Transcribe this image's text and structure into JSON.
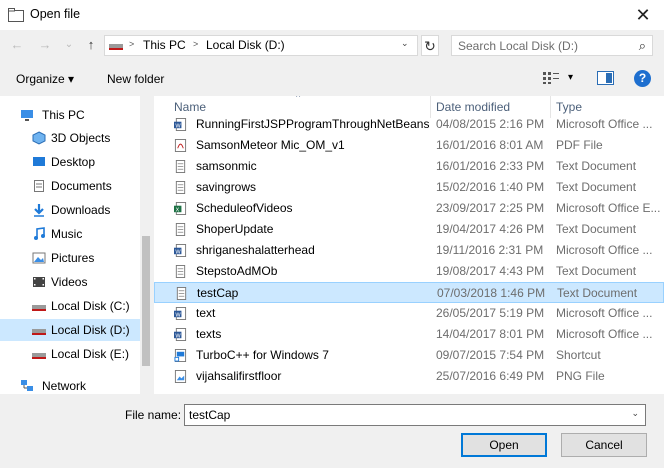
{
  "window": {
    "title": "Open file",
    "close_glyph": "✕"
  },
  "nav": {
    "back": "←",
    "forward": "→",
    "recent": "⌄",
    "up": "↑"
  },
  "address": {
    "sep1": ">",
    "crumb1": "This PC",
    "sep2": ">",
    "crumb2": "Local Disk (D:)",
    "dropdown": "⌄",
    "refresh": "↻"
  },
  "search": {
    "placeholder": "Search Local Disk (D:)",
    "icon": "⌕"
  },
  "toolbar": {
    "organize": "Organize ▾",
    "new_folder": "New folder",
    "view_dd": "▾",
    "help": "?"
  },
  "sidebar": {
    "items": [
      {
        "label": "This PC",
        "icon": "pc-icon",
        "expand": ""
      },
      {
        "label": "3D Objects",
        "icon": "3d-objects-icon",
        "expand": ""
      },
      {
        "label": "Desktop",
        "icon": "desktop-icon",
        "expand": ""
      },
      {
        "label": "Documents",
        "icon": "documents-icon",
        "expand": ""
      },
      {
        "label": "Downloads",
        "icon": "downloads-icon",
        "expand": ""
      },
      {
        "label": "Music",
        "icon": "music-icon",
        "expand": ""
      },
      {
        "label": "Pictures",
        "icon": "pictures-icon",
        "expand": ""
      },
      {
        "label": "Videos",
        "icon": "videos-icon",
        "expand": ""
      },
      {
        "label": "Local Disk (C:)",
        "icon": "drive-icon",
        "expand": ""
      },
      {
        "label": "Local Disk (D:)",
        "icon": "drive-icon",
        "expand": ""
      },
      {
        "label": "Local Disk (E:)",
        "icon": "drive-icon",
        "expand": ""
      },
      {
        "label": "Network",
        "icon": "network-icon",
        "expand": ""
      }
    ]
  },
  "files": {
    "headers": {
      "name": "Name",
      "date": "Date modified",
      "type": "Type",
      "sort_arrow": "^"
    },
    "rows": [
      {
        "name": "RunningFirstJSPProgramThroughNetBeans",
        "date": "04/08/2015 2:16 PM",
        "type": "Microsoft Office ...",
        "icon": "word-icon"
      },
      {
        "name": "SamsonMeteor Mic_OM_v1",
        "date": "16/01/2016 8:01 AM",
        "type": "PDF File",
        "icon": "pdf-icon"
      },
      {
        "name": "samsonmic",
        "date": "16/01/2016 2:33 PM",
        "type": "Text Document",
        "icon": "text-file-icon"
      },
      {
        "name": "savingrows",
        "date": "15/02/2016 1:40 PM",
        "type": "Text Document",
        "icon": "text-file-icon"
      },
      {
        "name": "ScheduleofVideos",
        "date": "23/09/2017 2:25 PM",
        "type": "Microsoft Office E...",
        "icon": "excel-icon"
      },
      {
        "name": "ShoperUpdate",
        "date": "19/04/2017 4:26 PM",
        "type": "Text Document",
        "icon": "text-file-icon"
      },
      {
        "name": "shriganeshalatterhead",
        "date": "19/11/2016 2:31 PM",
        "type": "Microsoft Office ...",
        "icon": "word-icon"
      },
      {
        "name": "StepstoAdMOb",
        "date": "19/08/2017 4:43 PM",
        "type": "Text Document",
        "icon": "text-file-icon"
      },
      {
        "name": "testCap",
        "date": "07/03/2018 1:46 PM",
        "type": "Text Document",
        "icon": "text-file-icon"
      },
      {
        "name": "text",
        "date": "26/05/2017 5:19 PM",
        "type": "Microsoft Office ...",
        "icon": "word-icon"
      },
      {
        "name": "texts",
        "date": "14/04/2017 8:01 PM",
        "type": "Microsoft Office ...",
        "icon": "word-icon"
      },
      {
        "name": "TurboC++ for Windows 7",
        "date": "09/07/2015 7:54 PM",
        "type": "Shortcut",
        "icon": "shortcut-icon"
      },
      {
        "name": "vijahsalifirstfloor",
        "date": "25/07/2016 6:49 PM",
        "type": "PNG File",
        "icon": "image-file-icon"
      }
    ]
  },
  "footer": {
    "file_name_label": "File name:",
    "file_name_value": "testCap",
    "dropdown": "⌄",
    "open": "Open",
    "cancel": "Cancel"
  },
  "colors": {
    "selection": "#cce8ff",
    "selection_border": "#99d1ff",
    "accent": "#0078d7",
    "header_text": "#4c607a"
  }
}
